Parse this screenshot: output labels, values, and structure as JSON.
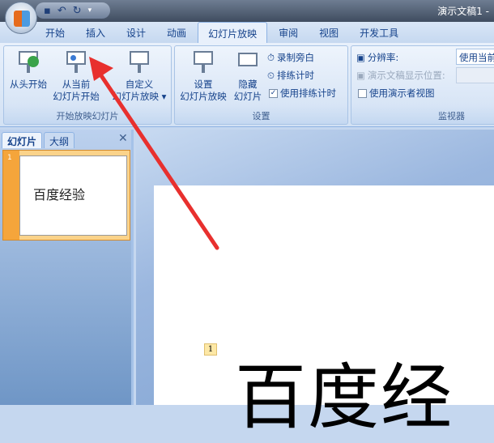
{
  "window": {
    "title": "演示文稿1 -"
  },
  "tabs": [
    "开始",
    "插入",
    "设计",
    "动画",
    "幻灯片放映",
    "审阅",
    "视图",
    "开发工具"
  ],
  "active_tab": "幻灯片放映",
  "ribbon": {
    "start_group": {
      "label": "开始放映幻灯片",
      "from_beginning": "从头开始",
      "from_current_1": "从当前",
      "from_current_2": "幻灯片开始",
      "custom_1": "自定义",
      "custom_2": "幻灯片放映 ▾"
    },
    "setup_group": {
      "label": "设置",
      "setup_1": "设置",
      "setup_2": "幻灯片放映",
      "hide_1": "隐藏",
      "hide_2": "幻灯片",
      "record": "录制旁白",
      "rehearse": "排练计时",
      "use_timings": "使用排练计时",
      "use_timings_checked": true
    },
    "monitor_group": {
      "label": "监视器",
      "resolution": "分辨率:",
      "resolution_value": "使用当前",
      "show_on": "演示文稿显示位置:",
      "presenter_view": "使用演示者视图",
      "presenter_view_checked": false
    }
  },
  "panel": {
    "tab_slides": "幻灯片",
    "tab_outline": "大纲",
    "close": "✕",
    "slide_number": "1",
    "thumb_text": "百度经验"
  },
  "slide": {
    "placeholder_number": "1",
    "title_text": "百度经"
  },
  "colors": {
    "annotation_arrow": "#e8302e",
    "accent": "#15428b"
  }
}
